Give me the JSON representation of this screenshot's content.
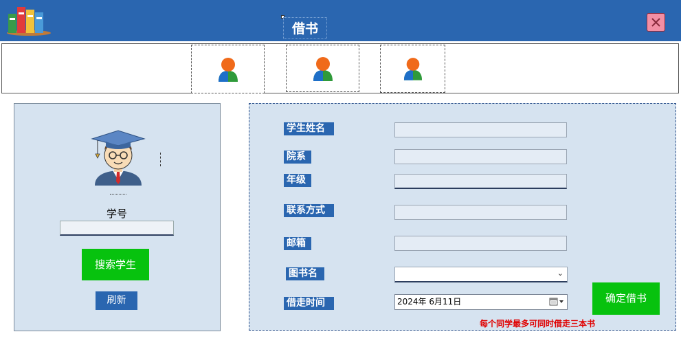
{
  "window": {
    "title": "借书"
  },
  "icons": {
    "logo": "books-logo-icon",
    "close": "close-icon",
    "student_slot": "user-icon",
    "avatar": "graduate-avatar-icon",
    "dropdown": "chevron-down-icon",
    "calendar": "calendar-icon"
  },
  "colors": {
    "titlebar": "#2a66b0",
    "panel": "#d6e3f0",
    "accent_green": "#07c20e",
    "label_blue": "#2a66b0",
    "warning_red": "#e00000"
  },
  "search": {
    "student_id_label": "学号",
    "student_id_value": "",
    "search_button": "搜索学生",
    "refresh_button": "刷新"
  },
  "form": {
    "name_label": "学生姓名",
    "name_value": "",
    "department_label": "院系",
    "department_value": "",
    "grade_label": "年级",
    "grade_value": "",
    "contact_label": "联系方式",
    "contact_value": "",
    "email_label": "邮箱",
    "email_value": "",
    "book_label": "图书名",
    "book_value": "",
    "borrow_time_label": "借走时间",
    "borrow_time_value": "2024年  6月11日",
    "confirm_button": "确定借书",
    "note": "每个同学最多可同时借走三本书"
  }
}
